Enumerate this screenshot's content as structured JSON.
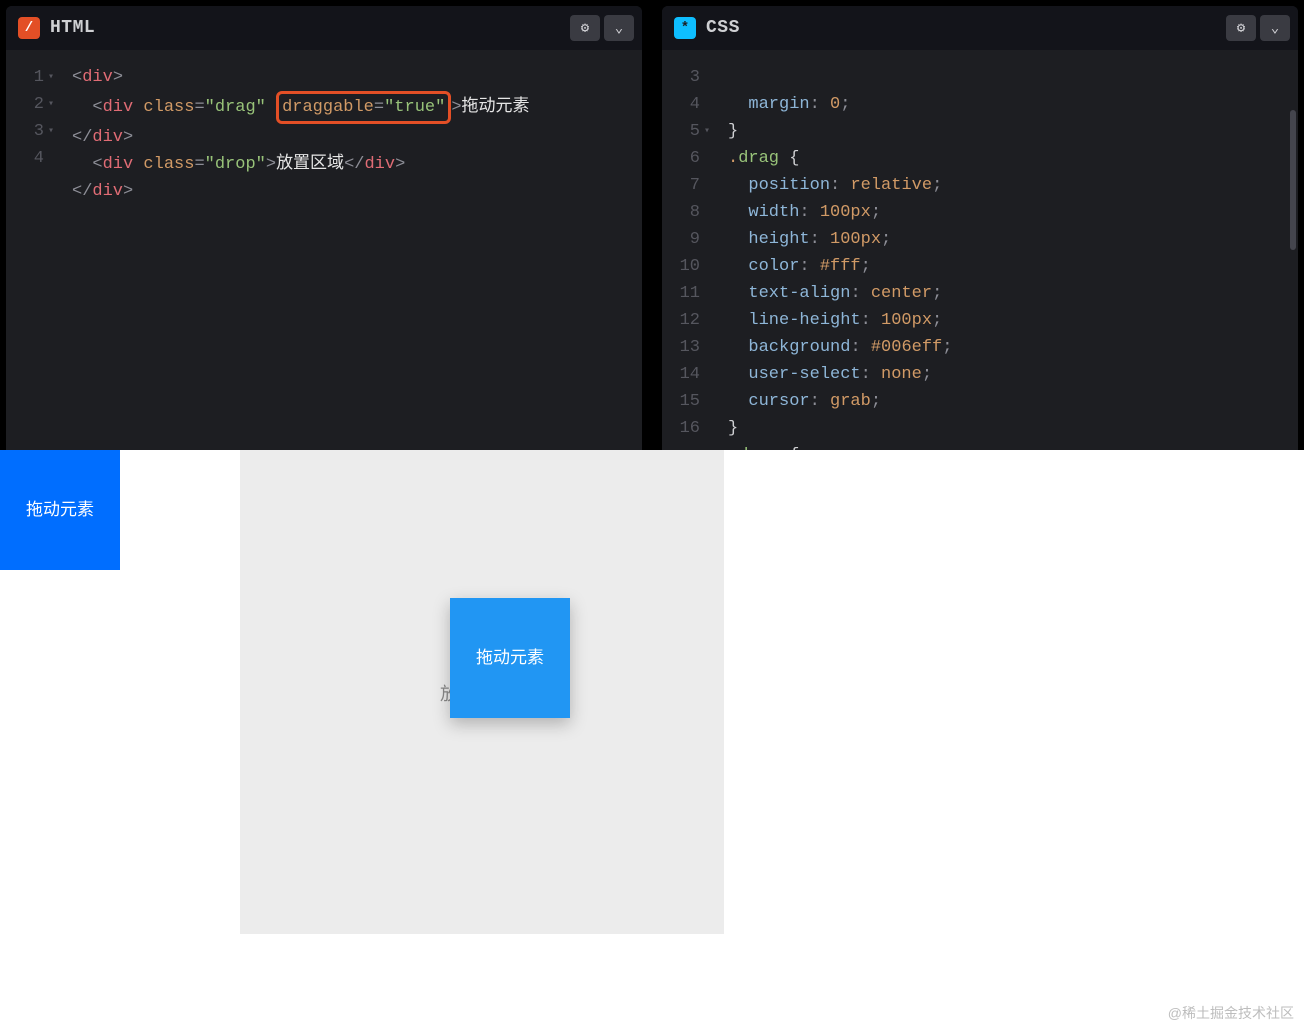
{
  "panels": {
    "html": {
      "badge": "/",
      "title": "HTML",
      "gutter": [
        "1",
        "2",
        "3",
        "4"
      ],
      "folds": [
        0,
        1,
        2
      ],
      "code": [
        [
          {
            "t": "<",
            "c": "t-punct"
          },
          {
            "t": "div",
            "c": "t-tag"
          },
          {
            "t": ">",
            "c": "t-punct"
          }
        ],
        [
          {
            "t": "  "
          },
          {
            "t": "<",
            "c": "t-punct"
          },
          {
            "t": "div",
            "c": "t-tag"
          },
          {
            "t": " "
          },
          {
            "t": "class",
            "c": "t-attr"
          },
          {
            "t": "=",
            "c": "t-punct"
          },
          {
            "t": "\"drag\"",
            "c": "t-val"
          },
          {
            "t": " "
          },
          {
            "wrap": "highlight-box",
            "inner": [
              {
                "t": "draggable",
                "c": "t-attr"
              },
              {
                "t": "=",
                "c": "t-punct"
              },
              {
                "t": "\"true\"",
                "c": "t-val"
              }
            ]
          },
          {
            "t": ">",
            "c": "t-punct"
          },
          {
            "t": "拖动元素",
            "c": "t-text"
          }
        ],
        [
          {
            "t": "</",
            "c": "t-punct"
          },
          {
            "t": "div",
            "c": "t-tag"
          },
          {
            "t": ">",
            "c": "t-punct"
          }
        ],
        [
          {
            "t": "  "
          },
          {
            "t": "<",
            "c": "t-punct"
          },
          {
            "t": "div",
            "c": "t-tag"
          },
          {
            "t": " "
          },
          {
            "t": "class",
            "c": "t-attr"
          },
          {
            "t": "=",
            "c": "t-punct"
          },
          {
            "t": "\"drop\"",
            "c": "t-val"
          },
          {
            "t": ">",
            "c": "t-punct"
          },
          {
            "t": "放置区域",
            "c": "t-text"
          },
          {
            "t": "</",
            "c": "t-punct"
          },
          {
            "t": "div",
            "c": "t-tag"
          },
          {
            "t": ">",
            "c": "t-punct"
          }
        ],
        [
          {
            "t": "</",
            "c": "t-punct"
          },
          {
            "t": "div",
            "c": "t-tag"
          },
          {
            "t": ">",
            "c": "t-punct"
          }
        ]
      ],
      "gutter_override": [
        "1",
        "2",
        "",
        "3",
        "4"
      ]
    },
    "css": {
      "badge": "*",
      "title": "CSS",
      "gutter": [
        "",
        "3",
        "4",
        "5",
        "6",
        "7",
        "8",
        "9",
        "10",
        "11",
        "12",
        "13",
        "14",
        "15",
        "16"
      ],
      "folds": [
        3
      ],
      "code": [
        [
          {
            "t": "  "
          }
        ],
        [
          {
            "t": "  "
          },
          {
            "t": "margin",
            "c": "t-prop"
          },
          {
            "t": ": ",
            "c": "t-punct"
          },
          {
            "t": "0",
            "c": "t-num"
          },
          {
            "t": ";",
            "c": "t-punct"
          }
        ],
        [
          {
            "t": "}",
            "c": "t-br"
          }
        ],
        [
          {
            "t": ".",
            "c": "t-sel"
          },
          {
            "t": "drag",
            "c": "t-selc"
          },
          {
            "t": " {",
            "c": "t-br"
          }
        ],
        [
          {
            "t": "  "
          },
          {
            "t": "position",
            "c": "t-prop"
          },
          {
            "t": ": ",
            "c": "t-punct"
          },
          {
            "t": "relative",
            "c": "t-kw"
          },
          {
            "t": ";",
            "c": "t-punct"
          }
        ],
        [
          {
            "t": "  "
          },
          {
            "t": "width",
            "c": "t-prop"
          },
          {
            "t": ": ",
            "c": "t-punct"
          },
          {
            "t": "100px",
            "c": "t-num"
          },
          {
            "t": ";",
            "c": "t-punct"
          }
        ],
        [
          {
            "t": "  "
          },
          {
            "t": "height",
            "c": "t-prop"
          },
          {
            "t": ": ",
            "c": "t-punct"
          },
          {
            "t": "100px",
            "c": "t-num"
          },
          {
            "t": ";",
            "c": "t-punct"
          }
        ],
        [
          {
            "t": "  "
          },
          {
            "t": "color",
            "c": "t-prop"
          },
          {
            "t": ": ",
            "c": "t-punct"
          },
          {
            "t": "#fff",
            "c": "t-col"
          },
          {
            "t": ";",
            "c": "t-punct"
          }
        ],
        [
          {
            "t": "  "
          },
          {
            "t": "text-align",
            "c": "t-prop"
          },
          {
            "t": ": ",
            "c": "t-punct"
          },
          {
            "t": "center",
            "c": "t-kw"
          },
          {
            "t": ";",
            "c": "t-punct"
          }
        ],
        [
          {
            "t": "  "
          },
          {
            "t": "line-height",
            "c": "t-prop"
          },
          {
            "t": ": ",
            "c": "t-punct"
          },
          {
            "t": "100px",
            "c": "t-num"
          },
          {
            "t": ";",
            "c": "t-punct"
          }
        ],
        [
          {
            "t": "  "
          },
          {
            "t": "background",
            "c": "t-prop"
          },
          {
            "t": ": ",
            "c": "t-punct"
          },
          {
            "t": "#006eff",
            "c": "t-col"
          },
          {
            "t": ";",
            "c": "t-punct"
          }
        ],
        [
          {
            "t": "  "
          },
          {
            "t": "user-select",
            "c": "t-prop"
          },
          {
            "t": ": ",
            "c": "t-punct"
          },
          {
            "t": "none",
            "c": "t-kw"
          },
          {
            "t": ";",
            "c": "t-punct"
          }
        ],
        [
          {
            "t": "  "
          },
          {
            "t": "cursor",
            "c": "t-prop"
          },
          {
            "t": ": ",
            "c": "t-punct"
          },
          {
            "t": "grab",
            "c": "t-kw"
          },
          {
            "t": ";",
            "c": "t-punct"
          }
        ],
        [
          {
            "t": "}",
            "c": "t-br"
          }
        ],
        [
          {
            "t": ".",
            "c": "t-sel"
          },
          {
            "t": "drop",
            "c": "t-selc"
          },
          {
            "t": " {",
            "c": "t-br"
          }
        ]
      ]
    }
  },
  "preview": {
    "drag_label": "拖动元素",
    "drop_label": "放置区域"
  },
  "watermark": "@稀土掘金技术社区"
}
